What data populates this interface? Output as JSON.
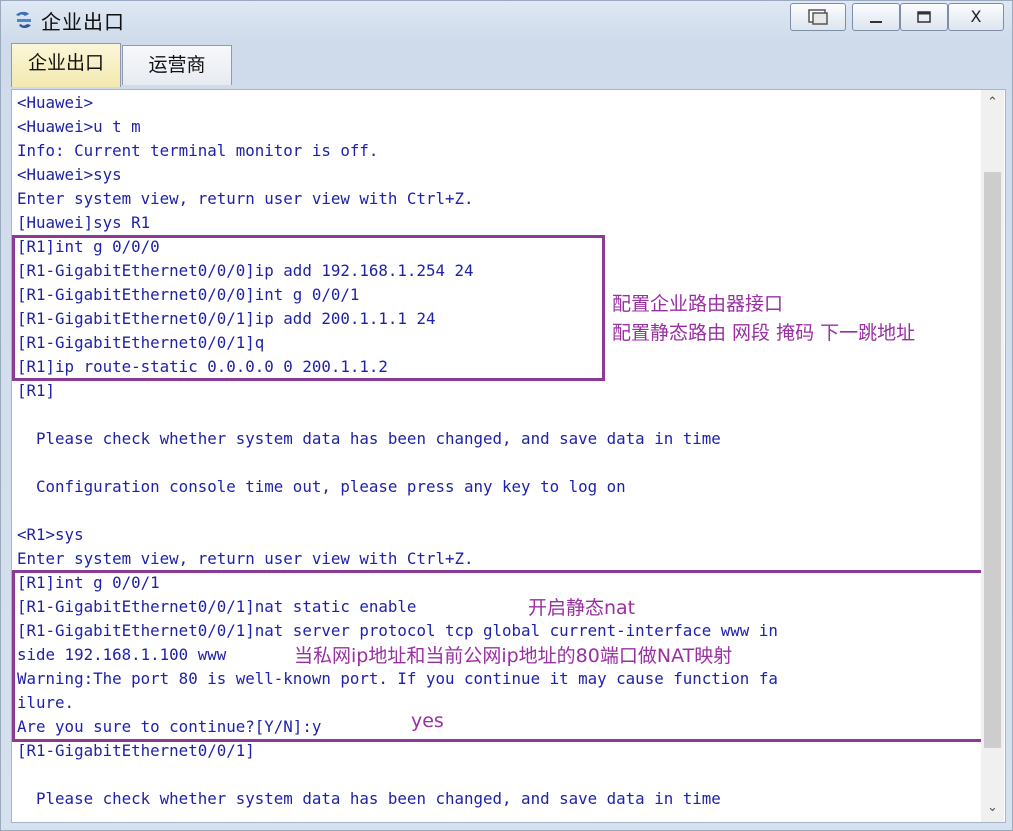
{
  "window": {
    "title": "企业出口",
    "buttons": {
      "restore": "",
      "minimize": "_",
      "maximize": "",
      "close": "X"
    }
  },
  "tabs": [
    {
      "label": "企业出口",
      "active": true
    },
    {
      "label": "运营商",
      "active": false
    }
  ],
  "terminal": {
    "lines": [
      "<Huawei>",
      "<Huawei>u t m",
      "Info: Current terminal monitor is off.",
      "<Huawei>sys",
      "Enter system view, return user view with Ctrl+Z.",
      "[Huawei]sys R1",
      "[R1]int g 0/0/0",
      "[R1-GigabitEthernet0/0/0]ip add 192.168.1.254 24",
      "[R1-GigabitEthernet0/0/0]int g 0/0/1",
      "[R1-GigabitEthernet0/0/1]ip add 200.1.1.1 24",
      "[R1-GigabitEthernet0/0/1]q",
      "[R1]ip route-static 0.0.0.0 0 200.1.1.2",
      "[R1]",
      "",
      "  Please check whether system data has been changed, and save data in time",
      "",
      "  Configuration console time out, please press any key to log on",
      "",
      "<R1>sys",
      "Enter system view, return user view with Ctrl+Z.",
      "[R1]int g 0/0/1",
      "[R1-GigabitEthernet0/0/1]nat static enable",
      "[R1-GigabitEthernet0/0/1]nat server protocol tcp global current-interface www in",
      "side 192.168.1.100 www",
      "Warning:The port 80 is well-known port. If you continue it may cause function fa",
      "ilure.",
      "Are you sure to continue?[Y/N]:y",
      "[R1-GigabitEthernet0/0/1]",
      "",
      "  Please check whether system data has been changed, and save data in time"
    ]
  },
  "annotations": {
    "router_interface": "配置企业路由器接口",
    "static_route": "配置静态路由 网段 掩码 下一跳地址",
    "static_nat": "开启静态nat",
    "nat_mapping": "当私网ip地址和当前公网ip地址的80端口做NAT映射",
    "confirm_yes": "yes"
  },
  "colors": {
    "terminal_text": "#1e22a8",
    "annotation": "#9a2fa4",
    "annotation_box": "#8c3a95",
    "active_tab": "#f3e9b0"
  }
}
